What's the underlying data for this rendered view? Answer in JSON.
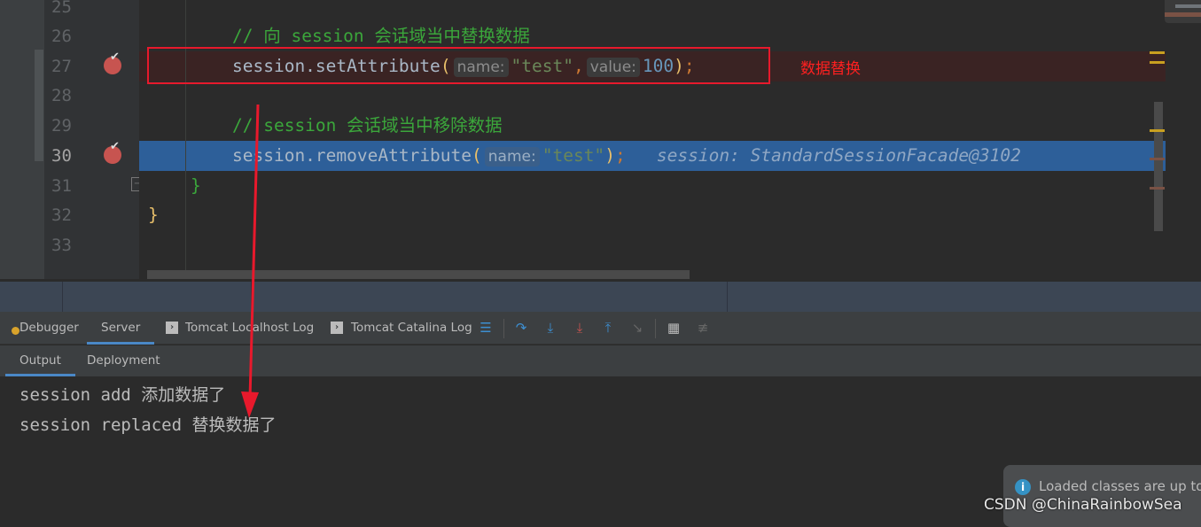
{
  "editor": {
    "line_numbers": [
      "25",
      "26",
      "27",
      "28",
      "29",
      "30",
      "31",
      "32",
      "33"
    ],
    "current_line": "30",
    "breakpoint_lines": [
      "27",
      "30"
    ],
    "lines": {
      "l26_comment": "// 向 session 会话域当中替换数据",
      "l27_obj": "session.setAttribute",
      "l27_hint1": "name:",
      "l27_arg1": "\"test\"",
      "l27_hint2": "value:",
      "l27_arg2": "100",
      "l29_comment": "// session 会话域当中移除数据",
      "l30_obj": "session.removeAttribute",
      "l30_hint1": "name:",
      "l30_arg1": "\"test\"",
      "l30_inline_value": "session: StandardSessionFacade@3102",
      "l31": "}",
      "l32": "}"
    },
    "annotation": "数据替换"
  },
  "toolbar": {
    "tabs": [
      {
        "label": "Debugger",
        "icon": "debugger-icon"
      },
      {
        "label": "Server",
        "active": true
      },
      {
        "label": "Tomcat Localhost Log",
        "icon": "console-log-icon"
      },
      {
        "label": "Tomcat Catalina Log",
        "icon": "console-log-icon"
      }
    ],
    "icons": [
      "show-execution-point-icon",
      "step-over-icon",
      "step-into-icon",
      "force-step-into-icon",
      "step-out-icon",
      "run-to-cursor-icon",
      "evaluate-expression-icon",
      "trace-icon"
    ]
  },
  "subtabs": [
    {
      "label": "Output",
      "active": true
    },
    {
      "label": "Deployment"
    }
  ],
  "console": {
    "lines": [
      "session add 添加数据了",
      "session replaced 替换数据了"
    ]
  },
  "notification": {
    "message": "Loaded classes are up to"
  },
  "watermark": "CSDN @ChinaRainbowSea",
  "colors": {
    "accent": "#4a88c7",
    "current_line": "#2d5f99",
    "breakpoint": "#c75450",
    "annotation": "#e8192c",
    "comment": "#3ba63b",
    "string": "#6a8759",
    "number": "#6897bb"
  }
}
